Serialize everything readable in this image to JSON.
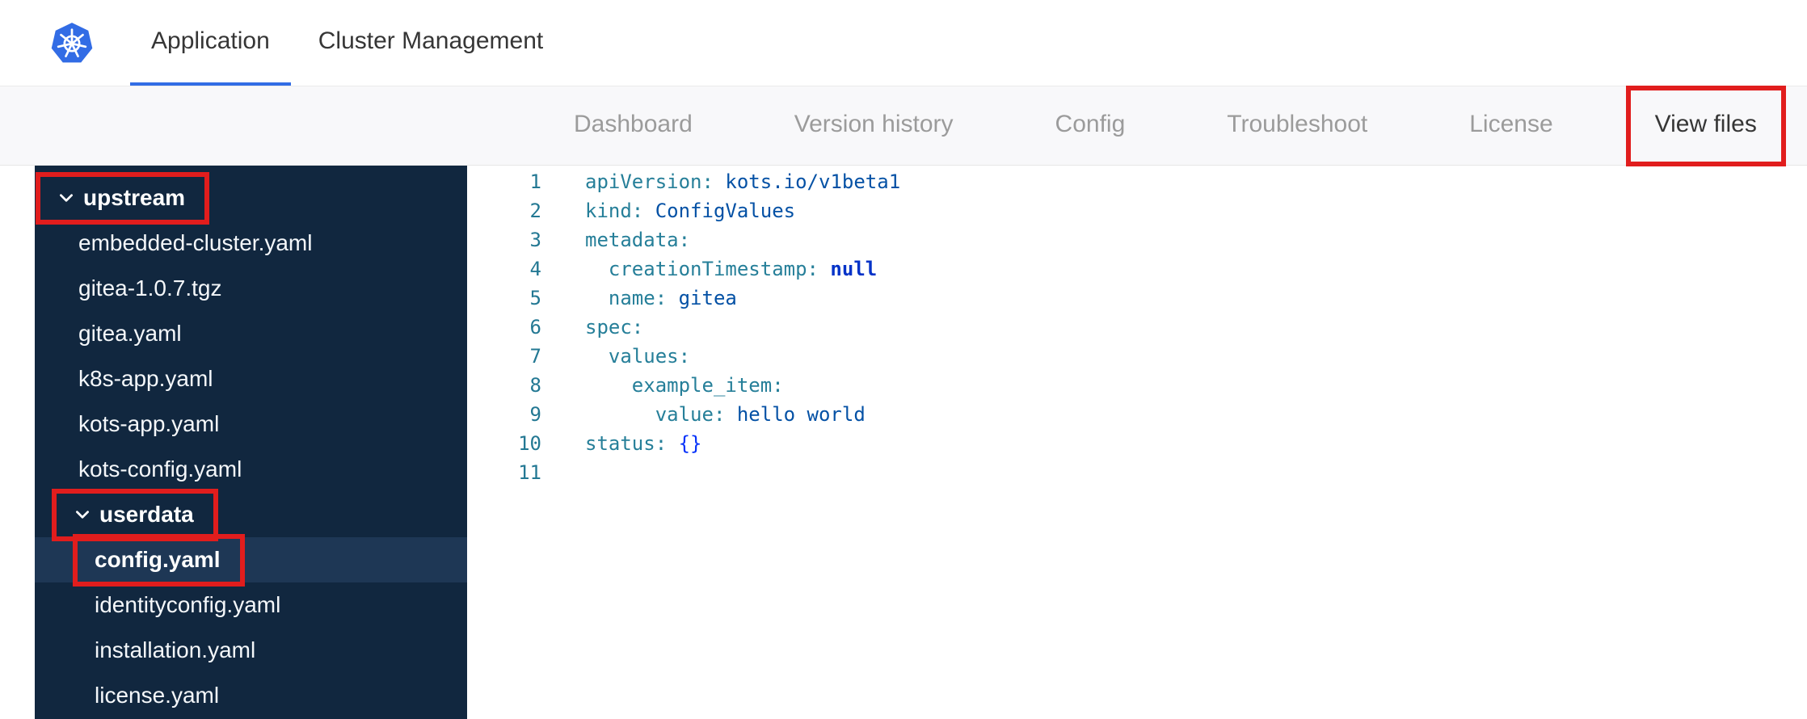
{
  "colors": {
    "accent_blue": "#326de5",
    "annotation_red": "#e11d1d",
    "sidebar_bg": "#11273f",
    "sidebar_selected_bg": "#1e3755",
    "subnav_bg": "#f8f8fa",
    "code_key": "#267f99",
    "code_value": "#0451a5",
    "code_keyword": "#0433c8",
    "line_number": "#237893"
  },
  "icons": {
    "logo": "kubernetes-helm-logo",
    "folder_toggle": "chevron-down-icon"
  },
  "topbar": {
    "tabs": [
      {
        "label": "Application",
        "active": true
      },
      {
        "label": "Cluster Management",
        "active": false
      }
    ]
  },
  "subnav": {
    "items": [
      {
        "label": "Dashboard",
        "active": false,
        "annotated": false
      },
      {
        "label": "Version history",
        "active": false,
        "annotated": false
      },
      {
        "label": "Config",
        "active": false,
        "annotated": false
      },
      {
        "label": "Troubleshoot",
        "active": false,
        "annotated": false
      },
      {
        "label": "License",
        "active": false,
        "annotated": false
      },
      {
        "label": "View files",
        "active": true,
        "annotated": true
      }
    ]
  },
  "file_tree": {
    "items": [
      {
        "label": "upstream",
        "kind": "folder",
        "expanded": true,
        "indent": 0,
        "selected": false,
        "annotated": true
      },
      {
        "label": "embedded-cluster.yaml",
        "kind": "file",
        "indent": 1,
        "selected": false,
        "annotated": false
      },
      {
        "label": "gitea-1.0.7.tgz",
        "kind": "file",
        "indent": 1,
        "selected": false,
        "annotated": false
      },
      {
        "label": "gitea.yaml",
        "kind": "file",
        "indent": 1,
        "selected": false,
        "annotated": false
      },
      {
        "label": "k8s-app.yaml",
        "kind": "file",
        "indent": 1,
        "selected": false,
        "annotated": false
      },
      {
        "label": "kots-app.yaml",
        "kind": "file",
        "indent": 1,
        "selected": false,
        "annotated": false
      },
      {
        "label": "kots-config.yaml",
        "kind": "file",
        "indent": 1,
        "selected": false,
        "annotated": false
      },
      {
        "label": "userdata",
        "kind": "folder",
        "expanded": true,
        "indent": 1,
        "selected": false,
        "annotated": true
      },
      {
        "label": "config.yaml",
        "kind": "file",
        "indent": 2,
        "selected": true,
        "annotated": true
      },
      {
        "label": "identityconfig.yaml",
        "kind": "file",
        "indent": 2,
        "selected": false,
        "annotated": false
      },
      {
        "label": "installation.yaml",
        "kind": "file",
        "indent": 2,
        "selected": false,
        "annotated": false
      },
      {
        "label": "license.yaml",
        "kind": "file",
        "indent": 2,
        "selected": false,
        "annotated": false
      }
    ]
  },
  "editor": {
    "language": "yaml",
    "lines": [
      {
        "num": "1",
        "segments": [
          {
            "text": "apiVersion:",
            "style": "key"
          },
          {
            "text": " kots.io/v1beta1",
            "style": "value"
          }
        ]
      },
      {
        "num": "2",
        "segments": [
          {
            "text": "kind:",
            "style": "key"
          },
          {
            "text": " ConfigValues",
            "style": "value"
          }
        ]
      },
      {
        "num": "3",
        "segments": [
          {
            "text": "metadata:",
            "style": "key"
          }
        ]
      },
      {
        "num": "4",
        "segments": [
          {
            "text": "  creationTimestamp:",
            "style": "key"
          },
          {
            "text": " null",
            "style": "keyword"
          }
        ]
      },
      {
        "num": "5",
        "segments": [
          {
            "text": "  name:",
            "style": "key"
          },
          {
            "text": " gitea",
            "style": "value"
          }
        ]
      },
      {
        "num": "6",
        "segments": [
          {
            "text": "spec:",
            "style": "key"
          }
        ]
      },
      {
        "num": "7",
        "segments": [
          {
            "text": "  values:",
            "style": "key"
          }
        ]
      },
      {
        "num": "8",
        "segments": [
          {
            "text": "    example_item:",
            "style": "key"
          }
        ]
      },
      {
        "num": "9",
        "segments": [
          {
            "text": "      value:",
            "style": "key"
          },
          {
            "text": " hello world",
            "style": "value"
          }
        ]
      },
      {
        "num": "10",
        "segments": [
          {
            "text": "status:",
            "style": "key"
          },
          {
            "text": " ",
            "style": "plain"
          },
          {
            "text": "{}",
            "style": "delimiter"
          }
        ]
      },
      {
        "num": "11",
        "segments": []
      }
    ]
  }
}
